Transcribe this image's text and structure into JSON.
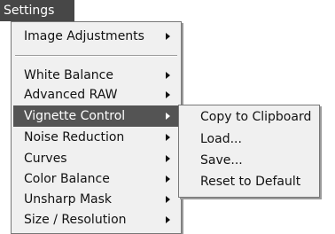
{
  "menubar": {
    "title": "Settings"
  },
  "menu": {
    "top_item": "Image Adjustments",
    "items": [
      "White Balance",
      "Advanced RAW",
      "Vignette Control",
      "Noise Reduction",
      "Curves",
      "Color Balance",
      "Unsharp Mask",
      "Size / Resolution"
    ],
    "selected_item": "Vignette Control"
  },
  "submenu": {
    "items": [
      "Copy to Clipboard",
      "Load...",
      "Save...",
      "Reset to Default"
    ]
  },
  "colors": {
    "menubar_bg": "#474747",
    "selected_bg": "#545454",
    "menu_bg": "#f0f0f0"
  }
}
